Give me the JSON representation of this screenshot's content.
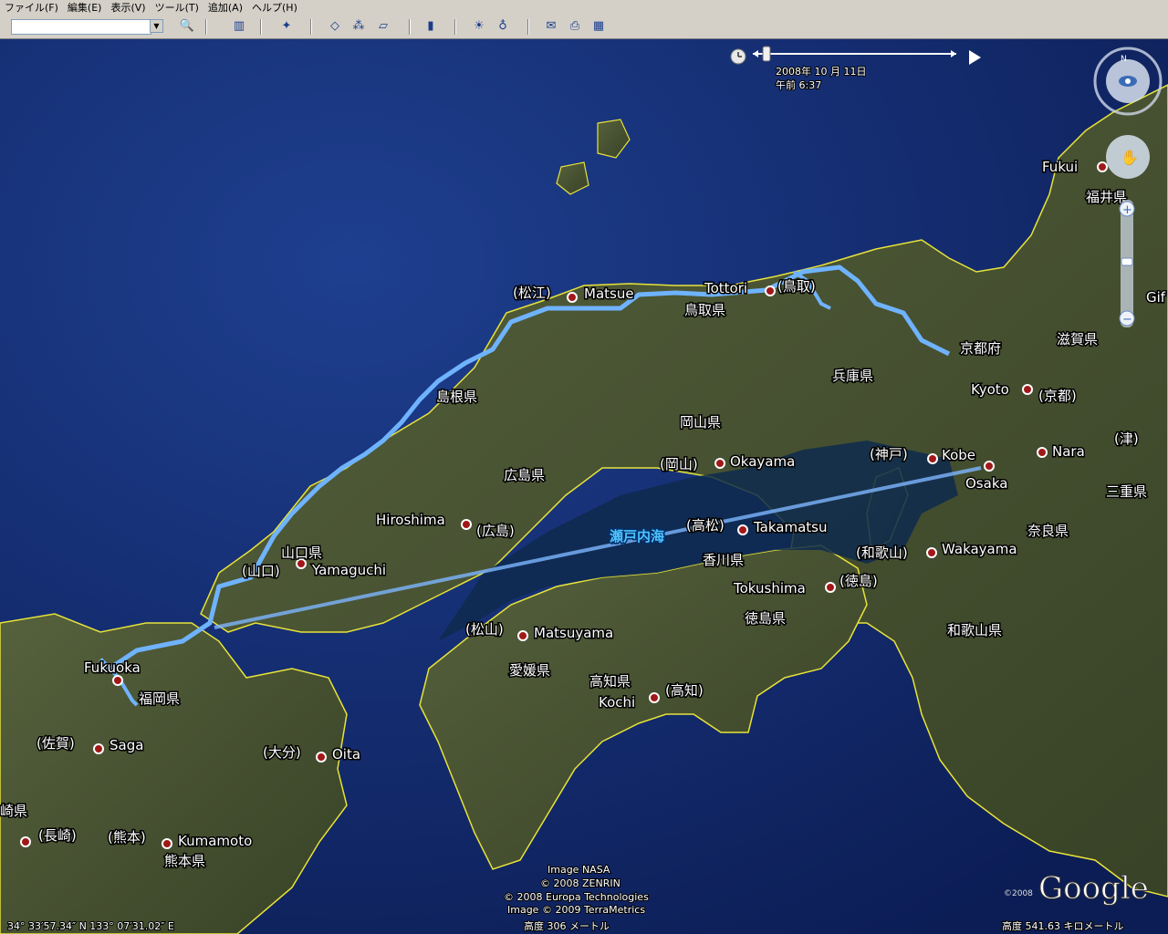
{
  "menu": [
    "ファイル(F)",
    "編集(E)",
    "表示(V)",
    "ツール(T)",
    "追加(A)",
    "ヘルプ(H)"
  ],
  "search": {
    "value": ""
  },
  "timeline": {
    "date": "2008年 10 月 11日",
    "time": "午前  6:37"
  },
  "cities": [
    {
      "name": "Fukui"
    },
    {
      "name": "Tottori"
    },
    {
      "name": "Matsue"
    },
    {
      "name": "(松江)"
    },
    {
      "name": "(鳥取)"
    },
    {
      "name": "Kyoto"
    },
    {
      "name": "(京都)"
    },
    {
      "name": "Kobe"
    },
    {
      "name": "(神戸)"
    },
    {
      "name": "Nara"
    },
    {
      "name": "(津)"
    },
    {
      "name": "Osaka"
    },
    {
      "name": "Okayama"
    },
    {
      "name": "(岡山)"
    },
    {
      "name": "Hiroshima"
    },
    {
      "name": "(広島)"
    },
    {
      "name": "Takamatsu"
    },
    {
      "name": "(高松)"
    },
    {
      "name": "Yamaguchi"
    },
    {
      "name": "(山口)"
    },
    {
      "name": "Wakayama"
    },
    {
      "name": "(和歌山)"
    },
    {
      "name": "Tokushima"
    },
    {
      "name": "(徳島)"
    },
    {
      "name": "Matsuyama"
    },
    {
      "name": "(松山)"
    },
    {
      "name": "Fukuoka"
    },
    {
      "name": "Kochi"
    },
    {
      "name": "(高知)"
    },
    {
      "name": "Saga"
    },
    {
      "name": "(佐賀)"
    },
    {
      "name": "Oita"
    },
    {
      "name": "(大分)"
    },
    {
      "name": "Kumamoto"
    },
    {
      "name": "(熊本)"
    },
    {
      "name": "(長崎)"
    },
    {
      "name": "Gif"
    }
  ],
  "prefectures": [
    "福井県",
    "鳥取県",
    "京都府",
    "滋賀県",
    "兵庫県",
    "島根県",
    "岡山県",
    "広島県",
    "三重県",
    "奈良県",
    "山口県",
    "香川県",
    "徳島県",
    "和歌山県",
    "愛媛県",
    "高知県",
    "福岡県",
    "熊本県",
    "崎県"
  ],
  "sea": "瀬戸内海",
  "credits": [
    "Image NASA",
    "© 2008 ZENRIN",
    "© 2008 Europa Technologies",
    "Image © 2009 TerraMetrics"
  ],
  "status": {
    "coords": "34° 33′57.34″ N  133° 07′31.02″ E",
    "elev": "高度  306 メートル",
    "eye": "高度  541.63 キロメートル"
  },
  "logo": {
    "year": "©2008",
    "brand": "Google"
  },
  "colors": {
    "route": "#6fb3ff",
    "ocean": "#0d1f5c",
    "land": "#3f4a2e",
    "border": "#e7e33a"
  }
}
